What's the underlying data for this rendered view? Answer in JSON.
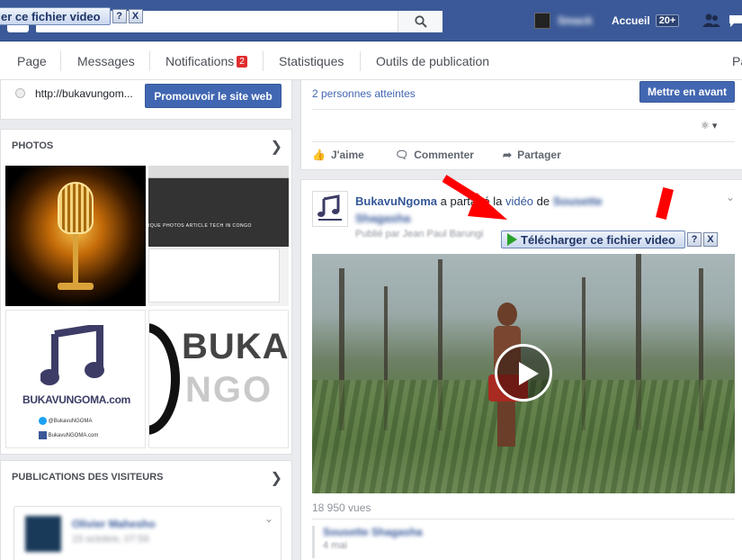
{
  "topbar": {
    "search_placeholder": "",
    "profile_name": "Smack",
    "home_label": "Accueil",
    "home_count": "20+"
  },
  "pagenav": {
    "tabs": [
      "Page",
      "Messages",
      "Notifications",
      "Statistiques",
      "Outils de publication",
      "Pa"
    ],
    "notifications_count": "2"
  },
  "left": {
    "website_url": "http://bukavungom...",
    "promote_label": "Promouvoir le site web",
    "photos_title": "PHOTOS",
    "photo_brand": "BUKAVUNGOMA.com",
    "photo_social_1": "@BukavuNGOMA",
    "photo_social_2": "BukavuNGOMA.com",
    "photo_banner_top": "BUKA",
    "photo_banner_bottom": "NGO",
    "photo_menu_text": "IQUE   PHOTOS   ARTICLE   TECH IN CONGO",
    "visitors_title": "PUBLICATIONS DES VISITEURS",
    "visitor_name": "Olivier Mahesho",
    "visitor_date": "15 octobre, 07:59"
  },
  "right": {
    "reach_text": "2 personnes atteintes",
    "boost_label": "Mettre en avant",
    "actions": [
      "J'aime",
      "Commenter",
      "Partager"
    ],
    "post_author": "BukavuNgoma",
    "post_verb": "a partagé la",
    "post_video_link": "vidéo",
    "post_of": "de",
    "post_original_author": "Sousette Shagasha",
    "post_sub": "Publié par Jean Paul Barungi",
    "views": "18 950 vues",
    "comment_author": "Sousette Shagasha",
    "comment_date": "4 mai"
  },
  "downloader": {
    "label": "Télécharger ce fichier video",
    "label_clipped": "er ce fichier video",
    "help": "?",
    "close": "X"
  },
  "colors": {
    "brand_blue": "#3b5998",
    "button_blue": "#4267b2",
    "annotation_red": "#ff0000",
    "badge_red": "#e02e2e"
  }
}
